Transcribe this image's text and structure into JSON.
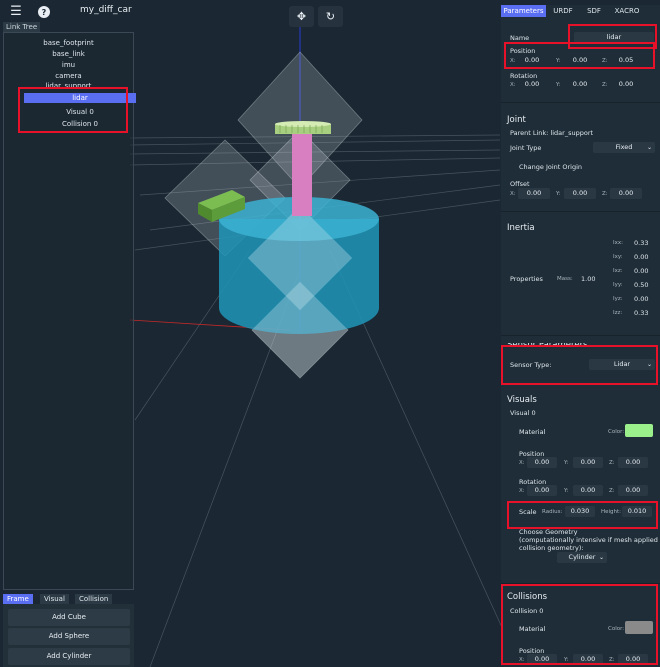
{
  "app": {
    "title": "my_diff_car"
  },
  "left_panel": {
    "tab_label": "Link Tree",
    "tree_items": [
      "base_footprint",
      "base_link",
      "imu",
      "camera",
      "lidar_support",
      "lidar",
      "Visual 0",
      "Collision 0"
    ],
    "selected": "lidar",
    "bottom_tabs": [
      "Frame",
      "Visual",
      "Collision"
    ],
    "active_bottom_tab": "Frame",
    "add_buttons": [
      "Add Cube",
      "Add Sphere",
      "Add Cylinder"
    ]
  },
  "right_panel": {
    "tabs": [
      "Parameters",
      "URDF",
      "SDF",
      "XACRO"
    ],
    "active_tab": "Parameters",
    "name_label": "Name",
    "name_value": "lidar",
    "position": {
      "label": "Position",
      "x": "0.00",
      "y": "0.00",
      "z": "0.05"
    },
    "rotation": {
      "label": "Rotation",
      "x": "0.00",
      "y": "0.00",
      "z": "0.00"
    },
    "axis_labels": {
      "x": "X:",
      "y": "Y:",
      "z": "Z:"
    },
    "joint": {
      "heading": "Joint",
      "parent_link_label": "Parent Link: lidar_support",
      "joint_type_label": "Joint Type",
      "joint_type_value": "Fixed",
      "change_origin_label": "Change Joint Origin",
      "offset": {
        "label": "Offset",
        "x": "0.00",
        "y": "0.00",
        "z": "0.00"
      }
    },
    "inertia": {
      "heading": "Inertia",
      "properties_label": "Properties",
      "mass_label": "Mass:",
      "mass_value": "1.00",
      "rows": [
        {
          "label": "Ixx:",
          "value": "0.33"
        },
        {
          "label": "Ixy:",
          "value": "0.00"
        },
        {
          "label": "Ixz:",
          "value": "0.00"
        },
        {
          "label": "Iyy:",
          "value": "0.50"
        },
        {
          "label": "Iyz:",
          "value": "0.00"
        },
        {
          "label": "Izz:",
          "value": "0.33"
        }
      ]
    },
    "sensor": {
      "heading": "Sensor Parameters",
      "type_label": "Sensor Type:",
      "type_value": "Lidar"
    },
    "visuals": {
      "heading": "Visuals",
      "item_label": "Visual 0",
      "material_label": "Material",
      "color_label": "Color:",
      "color_hex": "#9cf08b",
      "position": {
        "label": "Position",
        "x": "0.00",
        "y": "0.00",
        "z": "0.00"
      },
      "rotation": {
        "label": "Rotation",
        "x": "0.00",
        "y": "0.00",
        "z": "0.00"
      },
      "scale_label": "Scale",
      "radius_label": "Radius:",
      "radius_value": "0.030",
      "height_label": "Height:",
      "height_value": "0.010",
      "geometry_label_1": "Choose Geometry",
      "geometry_label_2": "(computationally intensive if mesh applied as",
      "geometry_label_3": "collision geometry):",
      "geometry_value": "Cylinder"
    },
    "collisions": {
      "heading": "Collisions",
      "item_label": "Collision 0",
      "material_label": "Material",
      "color_label": "Color:",
      "color_hex": "#8a8a8a",
      "position": {
        "label": "Position",
        "x": "0.00",
        "y": "0.00",
        "z": "0.00"
      }
    }
  },
  "colors": {
    "accent": "#5a6ef2",
    "highlight": "#e8112a",
    "cylinder": "#1f95b8",
    "lidar_disc": "#bfe39a",
    "support_pole": "#d77fc0",
    "camera_box": "#5d9c3a"
  },
  "icons": [
    "menu-icon",
    "help-icon",
    "move-icon",
    "refresh-icon",
    "chevron-down-icon"
  ]
}
